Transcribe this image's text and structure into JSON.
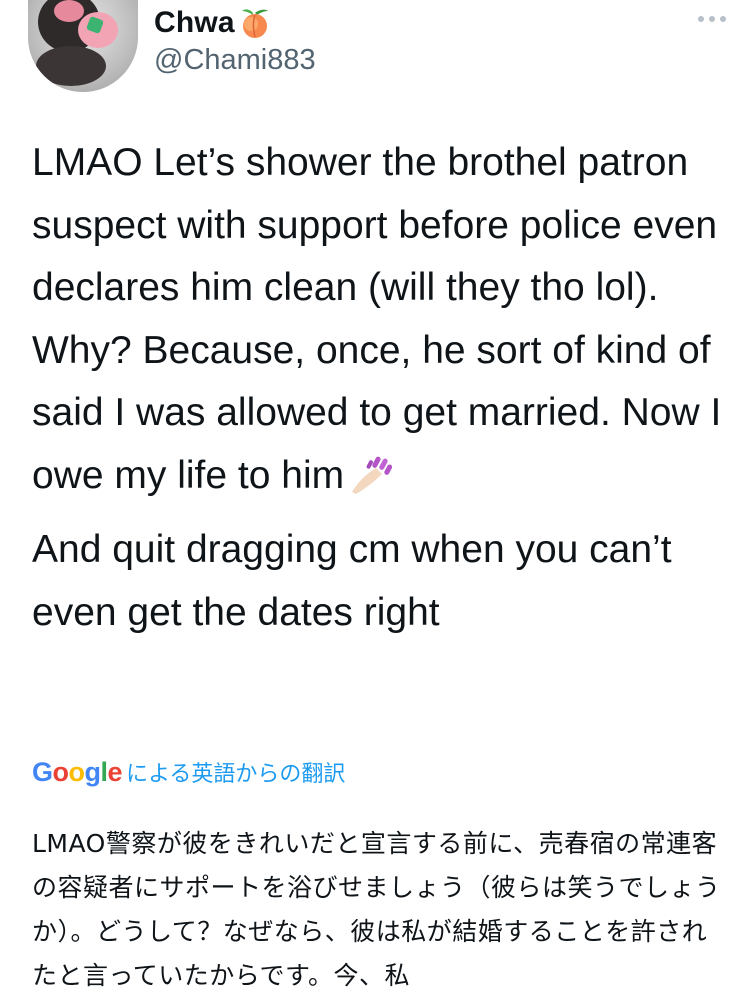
{
  "user": {
    "display_name": "Chwa",
    "handle": "@Chami883",
    "name_emoji": "peach-icon"
  },
  "tweet": {
    "paragraphs": [
      "LMAO Let’s shower the brothel patron suspect with support before police even declares him clean (will they tho lol). Why? Because, once, he sort of kind of said I was allowed to get married. Now I owe my life to him",
      "And quit dragging cm when you can’t even get the dates right"
    ],
    "trailing_emoji": "nail-polish-icon"
  },
  "translation": {
    "brand": "Google",
    "label": "による英語からの翻訳",
    "text": "LMAO警察が彼をきれいだと宣言する前に、売春宿の常連客の容疑者にサポートを浴びせましょう（彼らは笑うでしょうか）。どうして？なぜなら、彼は私が結婚することを許されたと言っていたからです。今、私"
  },
  "colors": {
    "link": "#1d9bf0",
    "secondary_text": "#536471"
  }
}
